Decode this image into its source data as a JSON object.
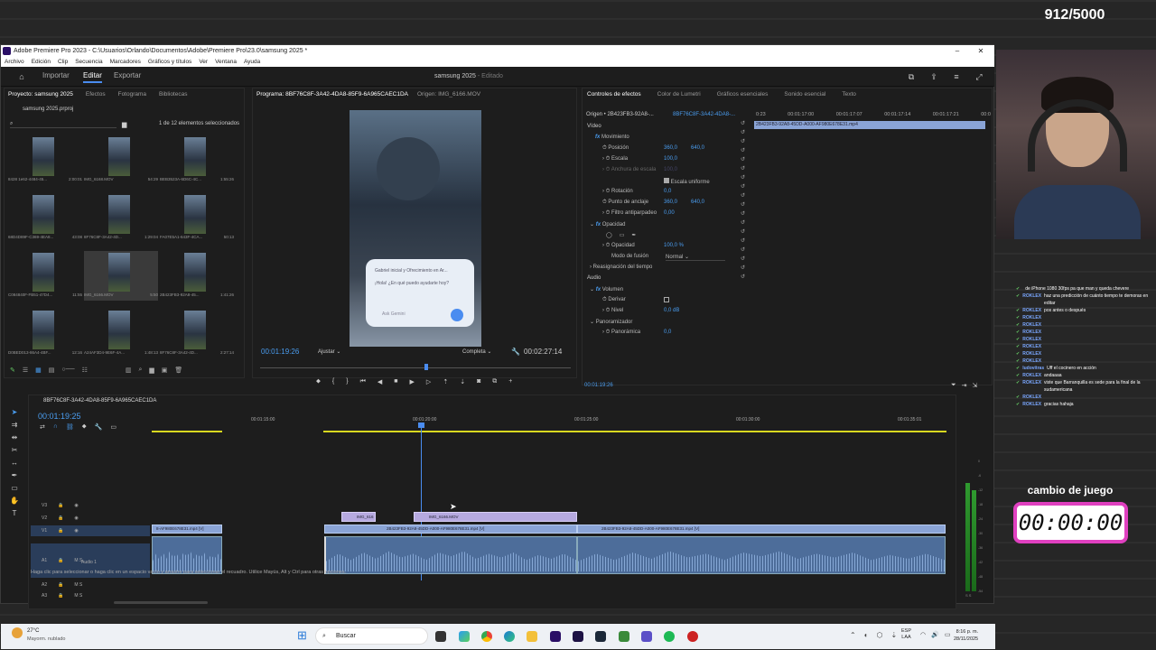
{
  "overlay": {
    "counter": "912/5000",
    "game_title": "cambio de juego",
    "game_timer": "00:00:00",
    "chat": [
      {
        "user": "",
        "text": "de iPhone 1080 30fps pa que man y queda chevere"
      },
      {
        "user": "ROKLEX",
        "text": "haz una predicción de cuánto tiempo te demoras en editar"
      },
      {
        "user": "ROKLEX",
        "text": "pos antes o después"
      },
      {
        "user": "ROKLEX",
        "text": ""
      },
      {
        "user": "ROKLEX",
        "text": ""
      },
      {
        "user": "ROKLEX",
        "text": ""
      },
      {
        "user": "ROKLEX",
        "text": ""
      },
      {
        "user": "ROKLEX",
        "text": ""
      },
      {
        "user": "ROKLEX",
        "text": ""
      },
      {
        "user": "ROKLEX",
        "text": ""
      },
      {
        "user": "ludovitras",
        "text": "Uff el cocinero en acción"
      },
      {
        "user": "ROKLEX",
        "text": "andaaaa"
      },
      {
        "user": "ROKLEX",
        "text": "viste que Barranquilla es sede para la final de la sudamericana"
      },
      {
        "user": "ROKLEX",
        "text": ""
      },
      {
        "user": "ROKLEX",
        "text": "gracias hahaja"
      }
    ]
  },
  "window": {
    "title": "Adobe Premiere Pro 2023 - C:\\Usuarios\\Orlando\\Documentos\\Adobe\\Premiere Pro\\23.0\\samsung 2025 *",
    "menu": [
      "Archivo",
      "Edición",
      "Clip",
      "Secuencia",
      "Marcadores",
      "Gráficos y títulos",
      "Ver",
      "Ventana",
      "Ayuda"
    ],
    "workspace_tabs": {
      "import": "Importar",
      "edit": "Editar",
      "export": "Exportar"
    },
    "doc_title": "samsung 2025",
    "doc_status": "- Editado"
  },
  "project": {
    "tabs": [
      "Proyecto: samsung 2025",
      "Efectos",
      "Fotograma",
      "Bibliotecas"
    ],
    "file": "samsung 2025.prproj",
    "selection": "1 de 12 elementos seleccionados",
    "items": [
      {
        "name": "8428 1e62-4484-45...",
        "dur": "2:00:01"
      },
      {
        "name": "IMG_6168.MOV",
        "dur": "54:29"
      },
      {
        "name": "BEB3523A-6D6C-4C...",
        "dur": "1:55:26"
      },
      {
        "name": "68D4D89F-C369-4EA8...",
        "dur": "43:08"
      },
      {
        "name": "8F76C8F-3A42-4D...",
        "dur": "1:29:04"
      },
      {
        "name": "FA07E5A1-643F-4CA...",
        "dur": "50:13"
      },
      {
        "name": "C084840F-FB51-47D4...",
        "dur": "11:55"
      },
      {
        "name": "IMG_6166.MOV",
        "dur": "5:50"
      },
      {
        "name": "2B423FB3-92A8-45...",
        "dur": "1:41:26"
      },
      {
        "name": "D0BED013-86A4-4BF...",
        "dur": "12:16"
      },
      {
        "name": "A24AF3D4-9E6F-4A...",
        "dur": "1:48:13"
      },
      {
        "name": "8F76C8F-3A42-4D...",
        "dur": "2:27:14"
      }
    ]
  },
  "monitor": {
    "program_tab": "Programa: 8BF76C8F-3A42-4DA8-85F9-6A965CAEC1DA",
    "source_tab": "Origen: IMG_6166.MOV",
    "timecode": "00:01:19:26",
    "fit": "Ajustar",
    "quality": "Completa",
    "duration": "00:02:27:14",
    "phone_text_1": "Gabriel inicial y Ofrecimiento en Ar...",
    "phone_text_2": "¡Hola! ¿En qué puedo ayudarte hoy?",
    "phone_input": "Ask Gemini"
  },
  "effects": {
    "tabs": [
      "Controles de efectos",
      "Color de Lumetri",
      "Gráficos esenciales",
      "Sonido esencial",
      "Texto"
    ],
    "source": "Origen • 2B423FB3-92A8-...",
    "target": "8BF76C8F-3A42-4DA8-...",
    "clip_name": "2B423FB3-92A8-45DD-A000-AF980E678E31.mp4",
    "ruler": [
      "0:23",
      "00:01:17:00",
      "00:01:17:07",
      "00:01:17:14",
      "00:01:17:21",
      "00:0"
    ],
    "video_header": "Vídeo",
    "audio_header": "Audio",
    "rows": {
      "motion": "Movimiento",
      "position": "Posición",
      "pos_x": "360,0",
      "pos_y": "640,0",
      "scale": "Escala",
      "scale_v": "100,0",
      "scale_w": "Anchura de escala",
      "scale_w_v": "100,0",
      "uniform": "Escala uniforme",
      "rotation": "Rotación",
      "rotation_v": "0,0",
      "anchor": "Punto de anclaje",
      "anchor_x": "360,0",
      "anchor_y": "640,0",
      "flicker": "Filtro antiparpadeo",
      "flicker_v": "0,00",
      "opacity_h": "Opacidad",
      "opacity": "Opacidad",
      "opacity_v": "100,0 %",
      "blend": "Modo de fusión",
      "blend_v": "Normal",
      "remap": "Reasignación del tiempo",
      "volume": "Volumen",
      "bypass": "Derivar",
      "level": "Nivel",
      "level_v": "0,0 dB",
      "panner": "Panoramizador",
      "balance": "Panorámica",
      "balance_v": "0,0"
    },
    "time": "00:01:19:26"
  },
  "timeline": {
    "sequence": "8BF76C8F-3A42-4DA8-85F9-6A965CAEC1DA",
    "timecode": "00:01:19:25",
    "ruler": [
      "00:01:15:00",
      "00:01:20:00",
      "00:01:25:00",
      "00:01:30:00",
      "00:01:35:01"
    ],
    "tracks": [
      "V3",
      "V2",
      "V1",
      "A1",
      "A2",
      "A3"
    ],
    "audio_label": "Audio 1",
    "clips_v2": [
      "IMG_616",
      "IMG_6166.MOV"
    ],
    "clips_v1": [
      "8-AF980E678E31.mp4 [V]",
      "2B423FB3-92A8-45DD-A000-AF980E678E31.mp4 [V]",
      "2B423FB3-92A8-45DD-A000-AF980E678E31.mp4 [V]"
    ],
    "meter_scale": [
      "0",
      "-6",
      "-12",
      "-18",
      "-24",
      "-30",
      "-36",
      "-42",
      "-48",
      "-54"
    ],
    "meter_foot": "S S"
  },
  "status_bar": "Haga clic para seleccionar o haga clic en un espacio vacío y arrastre para seleccionar el recuadro. Utilice Mayús, Alt y Ctrl para otras opciones.",
  "taskbar": {
    "weather_temp": "27°C",
    "weather_desc": "Mayorm. nublado",
    "search": "Buscar",
    "lang": "ESP",
    "lang2": "LAA",
    "time": "8:16 p. m.",
    "date": "28/11/2025"
  }
}
